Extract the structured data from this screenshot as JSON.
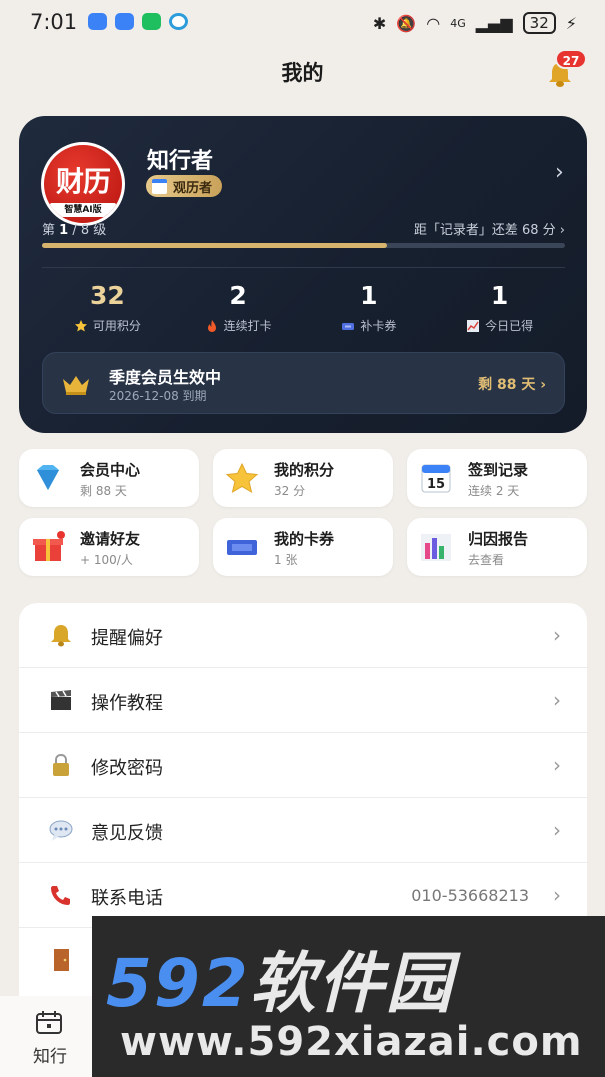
{
  "status": {
    "time": "7:01",
    "battery": "32",
    "network": "4G"
  },
  "header": {
    "title": "我的",
    "notification_count": "27"
  },
  "profile": {
    "avatar_text": "财历",
    "avatar_sub": "智慧AI版",
    "username": "知行者",
    "level_badge": "观历者",
    "level_prefix": "第",
    "level_current": "1",
    "level_total": " / 8 级",
    "level_next_text": "距「记录者」还差 68 分 ›",
    "level_progress": 0.66
  },
  "stats": [
    {
      "value": "32",
      "label": "可用积分",
      "icon": "star-icon"
    },
    {
      "value": "2",
      "label": "连续打卡",
      "icon": "flame-icon"
    },
    {
      "value": "1",
      "label": "补卡券",
      "icon": "ticket-icon"
    },
    {
      "value": "1",
      "label": "今日已得",
      "icon": "chart-line-icon"
    }
  ],
  "membership": {
    "title": "季度会员生效中",
    "expiry": "2026-12-08 到期",
    "remain": "剩 88 天 ›"
  },
  "tiles": [
    {
      "title": "会员中心",
      "sub": "剩 88 天",
      "icon": "diamond-icon"
    },
    {
      "title": "我的积分",
      "sub": "32 分",
      "icon": "star-icon"
    },
    {
      "title": "签到记录",
      "sub": "连续 2 天",
      "icon": "calendar-icon"
    },
    {
      "title": "邀请好友",
      "sub": "+ 100/人",
      "icon": "gift-icon"
    },
    {
      "title": "我的卡券",
      "sub": "1 张",
      "icon": "admit-ticket-icon"
    },
    {
      "title": "归因报告",
      "sub": "去查看",
      "icon": "bar-chart-icon"
    }
  ],
  "settings": [
    {
      "label": "提醒偏好",
      "value": "",
      "icon": "bell-icon"
    },
    {
      "label": "操作教程",
      "value": "",
      "icon": "clapper-icon"
    },
    {
      "label": "修改密码",
      "value": "",
      "icon": "lock-icon"
    },
    {
      "label": "意见反馈",
      "value": "",
      "icon": "speech-bubble-icon"
    },
    {
      "label": "联系电话",
      "value": "010-53668213",
      "icon": "phone-icon"
    },
    {
      "label": "",
      "value": "",
      "icon": "door-icon"
    }
  ],
  "nav": {
    "label": "知行"
  },
  "watermark": {
    "num": "592",
    "cn": "软件园",
    "url": "www.592xiazai.com"
  },
  "colors": {
    "card_bg": "#1a2333",
    "gold": "#d6b46e",
    "badge_red": "#e8342f",
    "page_bg": "#f1eeea"
  }
}
